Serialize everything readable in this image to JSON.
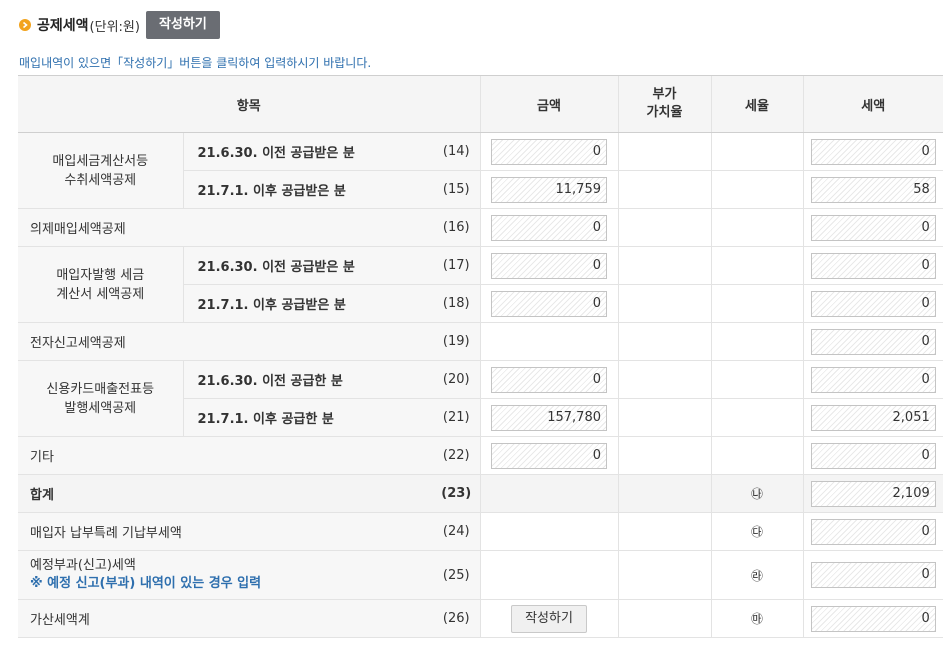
{
  "header": {
    "title": "공제세액",
    "unit": "(단위:원)",
    "write_button": "작성하기"
  },
  "notice": "매입내역이 있으면「작성하기」버튼을 클릭하여 입력하시기 바랍니다.",
  "columns": {
    "item": "항목",
    "amount": "금액",
    "vat_line1": "부가",
    "vat_line2": "가치율",
    "rate": "세율",
    "tax": "세액"
  },
  "groups": {
    "invoice_line1": "매입세금계산서등",
    "invoice_line2": "수취세액공제",
    "buyer_line1": "매입자발행 세금",
    "buyer_line2": "계산서 세액공제",
    "card_line1": "신용카드매출전표등",
    "card_line2": "발행세액공제"
  },
  "rows": {
    "r14": {
      "label": "21.6.30. 이전 공급받은 분",
      "code": "(14)",
      "amount": "0",
      "tax": "0"
    },
    "r15": {
      "label": "21.7.1. 이후 공급받은 분",
      "code": "(15)",
      "amount": "11,759",
      "tax": "58"
    },
    "r16": {
      "label": "의제매입세액공제",
      "code": "(16)",
      "amount": "0",
      "tax": "0"
    },
    "r17": {
      "label": "21.6.30. 이전 공급받은 분",
      "code": "(17)",
      "amount": "0",
      "tax": "0"
    },
    "r18": {
      "label": "21.7.1. 이후 공급받은 분",
      "code": "(18)",
      "amount": "0",
      "tax": "0"
    },
    "r19": {
      "label": "전자신고세액공제",
      "code": "(19)",
      "tax": "0"
    },
    "r20": {
      "label": "21.6.30. 이전 공급한 분",
      "code": "(20)",
      "amount": "0",
      "tax": "0"
    },
    "r21": {
      "label": "21.7.1. 이후 공급한 분",
      "code": "(21)",
      "amount": "157,780",
      "tax": "2,051"
    },
    "r22": {
      "label": "기타",
      "code": "(22)",
      "amount": "0",
      "tax": "0"
    },
    "r23": {
      "label": "합계",
      "code": "(23)",
      "rate_mark": "㉯",
      "tax": "2,109"
    },
    "r24": {
      "label": "매입자 납부특례 기납부세액",
      "code": "(24)",
      "rate_mark": "㉰",
      "tax": "0"
    },
    "r25": {
      "label": "예정부과(신고)세액",
      "note": "※ 예정 신고(부과) 내역이 있는 경우 입력",
      "code": "(25)",
      "rate_mark": "㉱",
      "tax": "0"
    },
    "r26": {
      "label": "가산세액계",
      "code": "(26)",
      "button": "작성하기",
      "rate_mark": "㉲",
      "tax": "0"
    }
  }
}
